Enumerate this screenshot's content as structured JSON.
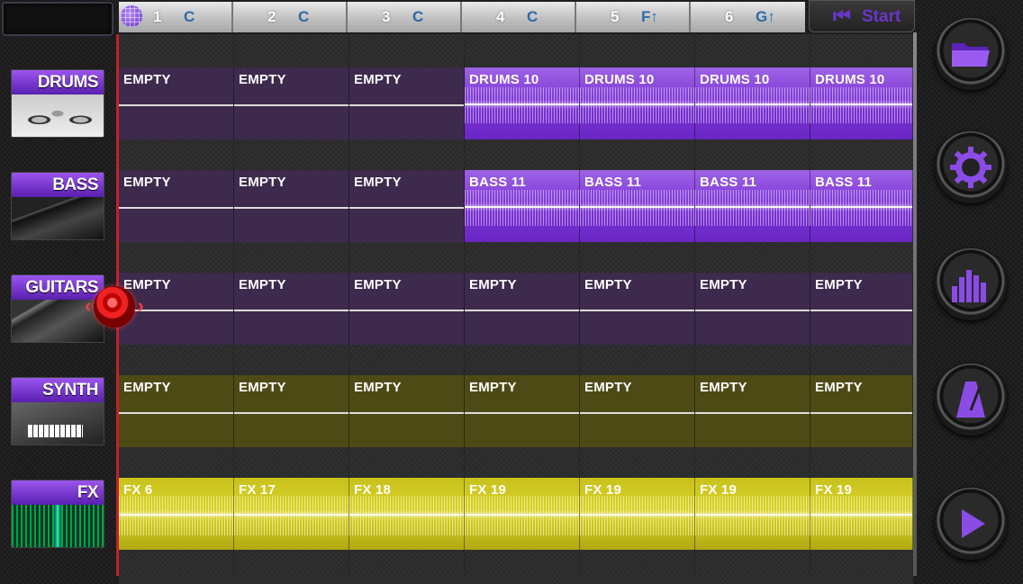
{
  "measures": [
    {
      "num": "1",
      "key": "C"
    },
    {
      "num": "2",
      "key": "C"
    },
    {
      "num": "3",
      "key": "C"
    },
    {
      "num": "4",
      "key": "C"
    },
    {
      "num": "5",
      "key": "F↑"
    },
    {
      "num": "6",
      "key": "G↑"
    }
  ],
  "start": {
    "label": "Start",
    "icon": "skip-to-start-icon"
  },
  "instruments": [
    {
      "label": "DRUMS",
      "icon": "drum-kit-image"
    },
    {
      "label": "BASS",
      "icon": "bass-guitar-image"
    },
    {
      "label": "GUITARS",
      "icon": "electric-guitar-image"
    },
    {
      "label": "SYNTH",
      "icon": "synthesizer-keyboard-image"
    },
    {
      "label": "FX",
      "icon": "fx-waveform-image"
    }
  ],
  "tracks": [
    {
      "name": "drums",
      "color": "purple",
      "clips": [
        "EMPTY",
        "EMPTY",
        "EMPTY",
        "DRUMS 10",
        "DRUMS 10",
        "DRUMS 10",
        "DRUMS 10"
      ]
    },
    {
      "name": "bass",
      "color": "purple",
      "clips": [
        "EMPTY",
        "EMPTY",
        "EMPTY",
        "BASS 11",
        "BASS 11",
        "BASS 11",
        "BASS 11"
      ]
    },
    {
      "name": "guitars",
      "color": "purple",
      "clips": [
        "EMPTY",
        "EMPTY",
        "EMPTY",
        "EMPTY",
        "EMPTY",
        "EMPTY",
        "EMPTY"
      ]
    },
    {
      "name": "synth",
      "color": "yellow",
      "clips": [
        "EMPTY",
        "EMPTY",
        "EMPTY",
        "EMPTY",
        "EMPTY",
        "EMPTY",
        "EMPTY"
      ]
    },
    {
      "name": "fx",
      "color": "yellow",
      "clips": [
        "FX 6",
        "FX 17",
        "FX 18",
        "FX 19",
        "FX 19",
        "FX 19",
        "FX 19"
      ]
    }
  ],
  "sidebar": [
    {
      "name": "open-folder-button",
      "icon": "folder-icon"
    },
    {
      "name": "settings-button",
      "icon": "gear-icon"
    },
    {
      "name": "mixer-button",
      "icon": "equalizer-icon"
    },
    {
      "name": "metronome-button",
      "icon": "metronome-icon"
    },
    {
      "name": "play-button",
      "icon": "play-icon"
    }
  ],
  "colors": {
    "accent": "#7b34d4",
    "clip_yellow": "#d9d22a",
    "playhead": "#c3202a",
    "key_text": "#2d6aa8"
  }
}
